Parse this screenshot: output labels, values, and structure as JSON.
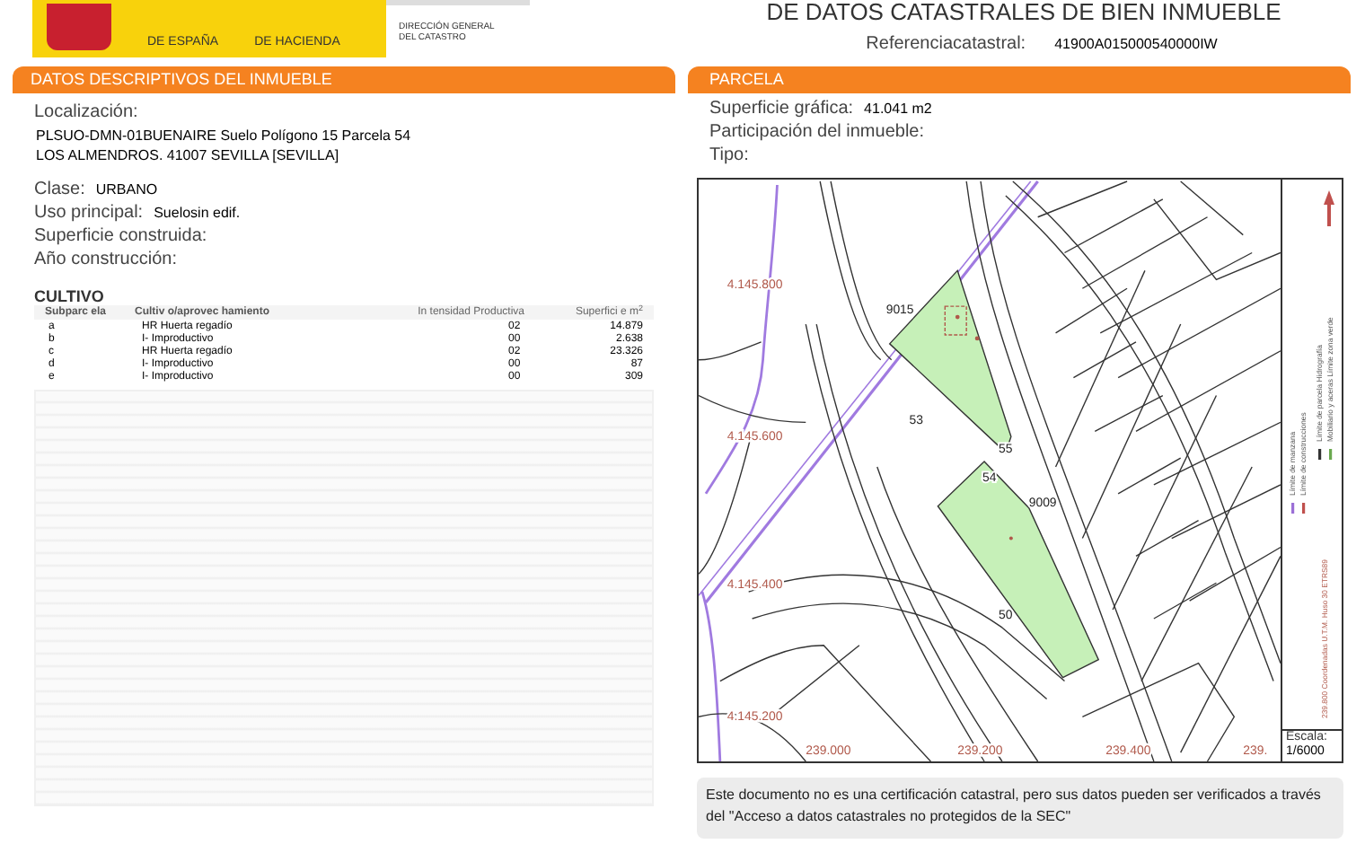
{
  "header": {
    "logo_lines": [
      "DE ESPAÑA",
      "DE HACIENDA"
    ],
    "agency_lines": [
      "DIRECCIÓN GENERAL",
      "DEL CATASTRO"
    ],
    "title": "DE DATOS CATASTRALES DE BIEN INMUEBLE",
    "reference": {
      "label": "Referenciacatastral:",
      "value": "41900A015000540000IW"
    }
  },
  "left_panel": {
    "title": "DATOS DESCRIPTIVOS DEL INMUEBLE",
    "location_label": "Localización:",
    "location_lines": [
      "PLSUO-DMN-01BUENAIRE Suelo Polígono 15 Parcela 54",
      "LOS ALMENDROS. 41007 SEVILLA [SEVILLA]"
    ],
    "fields": [
      {
        "label": "Clase:",
        "value": "URBANO"
      },
      {
        "label": "Uso principal:",
        "value": "Suelosin edif."
      },
      {
        "label": "Superficie construida:"
      },
      {
        "label": "Año construcción:"
      }
    ],
    "cultivo": {
      "title": "CULTIVO",
      "columns": [
        "Subparc ela",
        "Cultiv o/aprovec hamiento",
        "In tensidad Productiva",
        "Superfici e m$^{2}$"
      ],
      "rows": [
        [
          "a",
          "HR Huerta regadío",
          "02",
          "14.879"
        ],
        [
          "b",
          "I- Improductivo",
          "00",
          "2.638"
        ],
        [
          "c",
          "HR Huerta regadío",
          "02",
          "23.326"
        ],
        [
          "d",
          "I- Improductivo",
          "00",
          "87"
        ],
        [
          "e",
          "I- Improductivo",
          "00",
          "309"
        ]
      ]
    }
  },
  "right_panel": {
    "title": "PARCELA",
    "fields": [
      {
        "label": "Superficie gráfica:",
        "value": "41.041 m2"
      },
      {
        "label": "Participación del inmueble:"
      },
      {
        "label": "Tipo:"
      }
    ],
    "map": {
      "northing_labels": [
        "4.145.800",
        "4.145.600",
        "4.145.400",
        "4.145.200"
      ],
      "easting_labels": [
        "239.000",
        "239.200",
        "239.400",
        "239."
      ],
      "parcel_labels": [
        "9015",
        "53",
        "55",
        "54",
        "9009",
        "50"
      ],
      "legend": [
        {
          "label": "Límite de manzana",
          "color": "#9b6fd6"
        },
        {
          "label": "Límite de construcciones",
          "color": "#c0504d"
        },
        {
          "label": "Límite de parcela Hidrografía",
          "color": "#333333"
        },
        {
          "label": "Mobiliario y aceras Límite zona verde",
          "color": "#6aa84f"
        }
      ],
      "coordinate_note": "239.800 Coordenadas U.T.M. Huso 30 ETRS89",
      "scale_label": "Escala:",
      "scale_value": "1/6000"
    }
  },
  "footer": {
    "text": "Este documento no es una certificación catastral, pero sus datos pueden ser verificados a través del \"Acceso a datos catastrales no protegidos de la SEC\""
  }
}
